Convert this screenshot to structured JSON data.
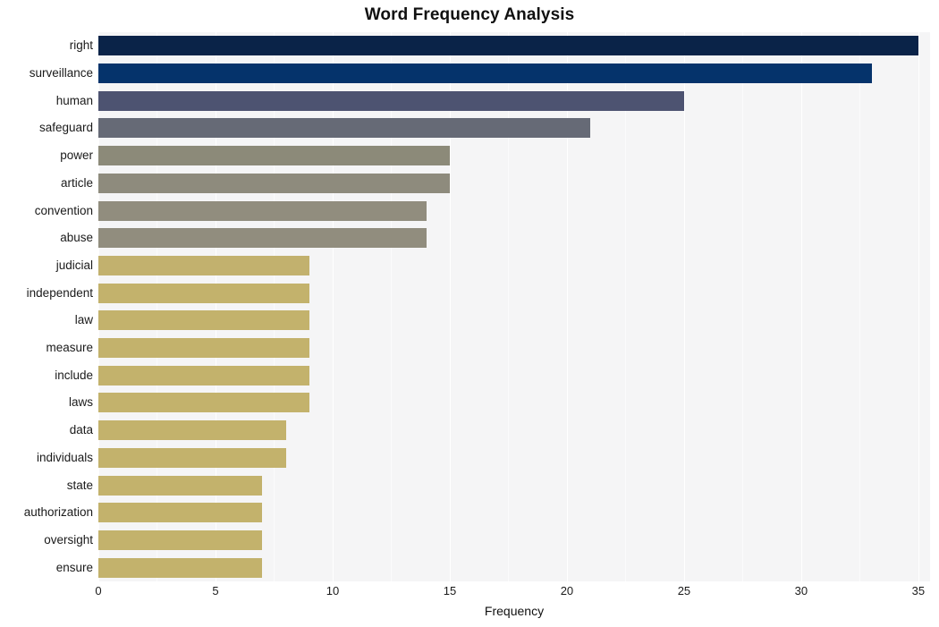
{
  "chart_data": {
    "type": "bar",
    "orientation": "horizontal",
    "title": "Word Frequency Analysis",
    "xlabel": "Frequency",
    "ylabel": "",
    "xlim": [
      0,
      35.5
    ],
    "xticks": [
      0,
      5,
      10,
      15,
      20,
      25,
      30,
      35
    ],
    "xtick_labels": [
      "0",
      "5",
      "10",
      "15",
      "20",
      "25",
      "30",
      "35"
    ],
    "grid": true,
    "legend": null,
    "categories": [
      "right",
      "surveillance",
      "human",
      "safeguard",
      "power",
      "article",
      "convention",
      "abuse",
      "judicial",
      "independent",
      "law",
      "measure",
      "include",
      "laws",
      "data",
      "individuals",
      "state",
      "authorization",
      "oversight",
      "ensure"
    ],
    "values": [
      35,
      33,
      25,
      21,
      15,
      15,
      14,
      14,
      9,
      9,
      9,
      9,
      9,
      9,
      8,
      8,
      7,
      7,
      7,
      7
    ],
    "bar_colors": [
      "#0a2348",
      "#05336b",
      "#4d5371",
      "#666a76",
      "#8c8a79",
      "#8e8b7d",
      "#918d7e",
      "#918d7e",
      "#c2b16e",
      "#c3b26c",
      "#c3b26c",
      "#c3b26c",
      "#c3b26c",
      "#c3b26c",
      "#c3b26c",
      "#c3b26c",
      "#c3b26c",
      "#c3b26c",
      "#c3b26c",
      "#c3b26c"
    ],
    "plot_background": "#f5f5f6",
    "figure_background": "#ffffff",
    "gridline_color": "#ffffff"
  }
}
